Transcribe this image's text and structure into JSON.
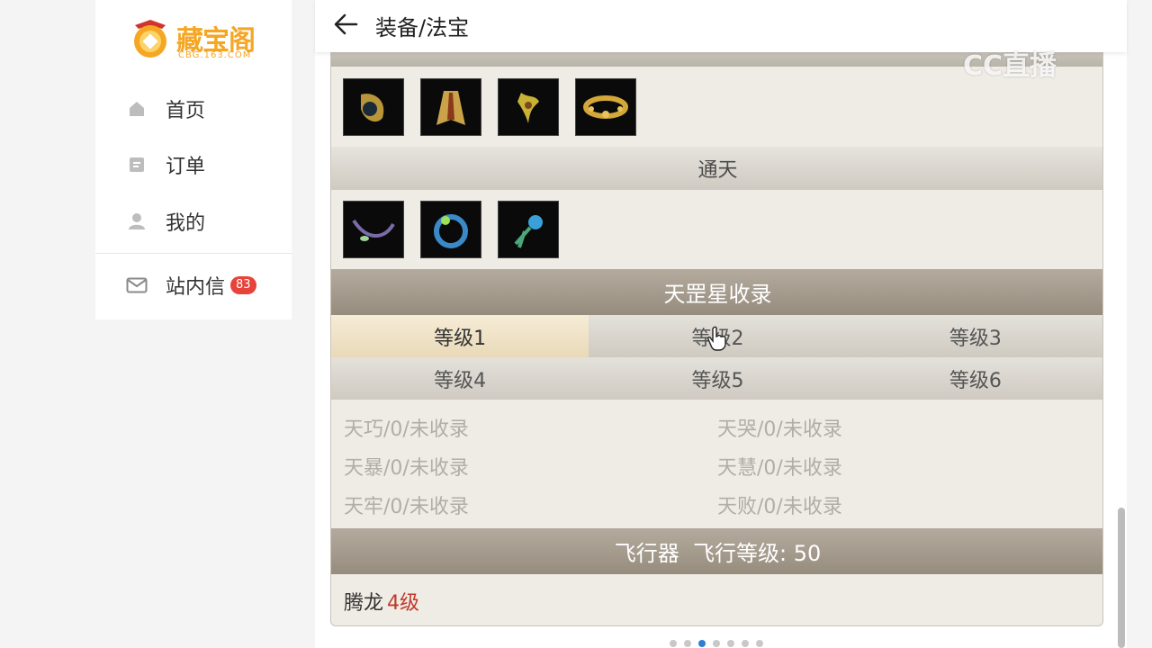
{
  "sidebar": {
    "logo": {
      "text": "藏宝阁",
      "sub": "CBG.163.COM"
    },
    "items": [
      {
        "label": "首页",
        "icon": "home-icon"
      },
      {
        "label": "订单",
        "icon": "order-icon"
      },
      {
        "label": "我的",
        "icon": "user-icon"
      }
    ],
    "messages": {
      "label": "站内信",
      "icon": "mail-icon",
      "badge": "83"
    }
  },
  "header": {
    "title": "装备/法宝",
    "back_icon": "back-arrow-icon"
  },
  "sections": {
    "tongtian": {
      "title": "通天"
    },
    "tiangang": {
      "title": "天罡星收录",
      "tabs": [
        "等级1",
        "等级2",
        "等级3",
        "等级4",
        "等级5",
        "等级6"
      ],
      "active_tab": "等级1",
      "entries": [
        [
          "天巧/0/未收录",
          "天哭/0/未收录"
        ],
        [
          "天暴/0/未收录",
          "天慧/0/未收录"
        ],
        [
          "天牢/0/未收录",
          "天败/0/未收录"
        ]
      ]
    },
    "flyer": {
      "title": "飞行器  飞行等级: 50",
      "name": "腾龙",
      "level": "4级"
    }
  },
  "watermark": "CC直播",
  "carousel": {
    "count": 7,
    "active_index": 2
  },
  "colors": {
    "accent": "#f5a623",
    "badge": "#e8433a",
    "level_red": "#c0392b",
    "active_dot": "#2d7fd3"
  }
}
